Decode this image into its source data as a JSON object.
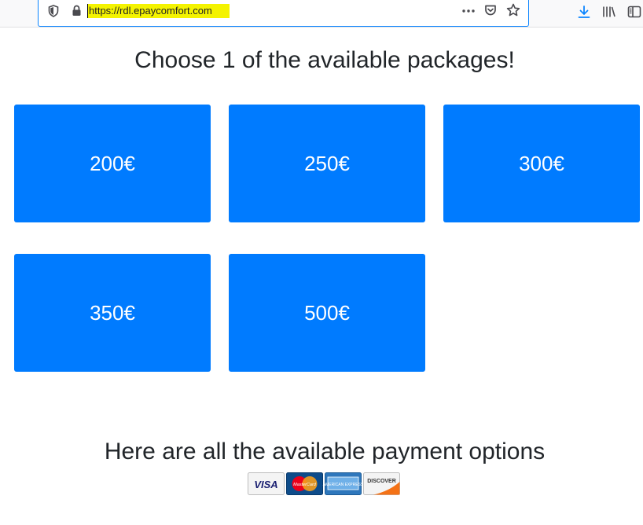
{
  "browser": {
    "url": "https://rdl.epaycomfort.com",
    "icons": [
      "shield-icon",
      "lock-icon",
      "more-icon",
      "pocket-icon",
      "star-icon",
      "download-icon",
      "library-icon",
      "sidebar-icon"
    ],
    "url_highlight_color": "#f4f300",
    "focus_color": "#0a84ff"
  },
  "main": {
    "title": "Choose 1 of the available packages!",
    "packages": [
      {
        "label": "200€"
      },
      {
        "label": "250€"
      },
      {
        "label": "300€"
      },
      {
        "label": "350€"
      },
      {
        "label": "500€"
      }
    ],
    "package_color": "#007bff"
  },
  "payment": {
    "title": "Here are all the available payment options",
    "cards": [
      {
        "label": "VISA"
      },
      {
        "label": "MasterCard"
      },
      {
        "label": "AMERICAN EXPRESS"
      },
      {
        "label": "DISCOVER"
      }
    ]
  }
}
